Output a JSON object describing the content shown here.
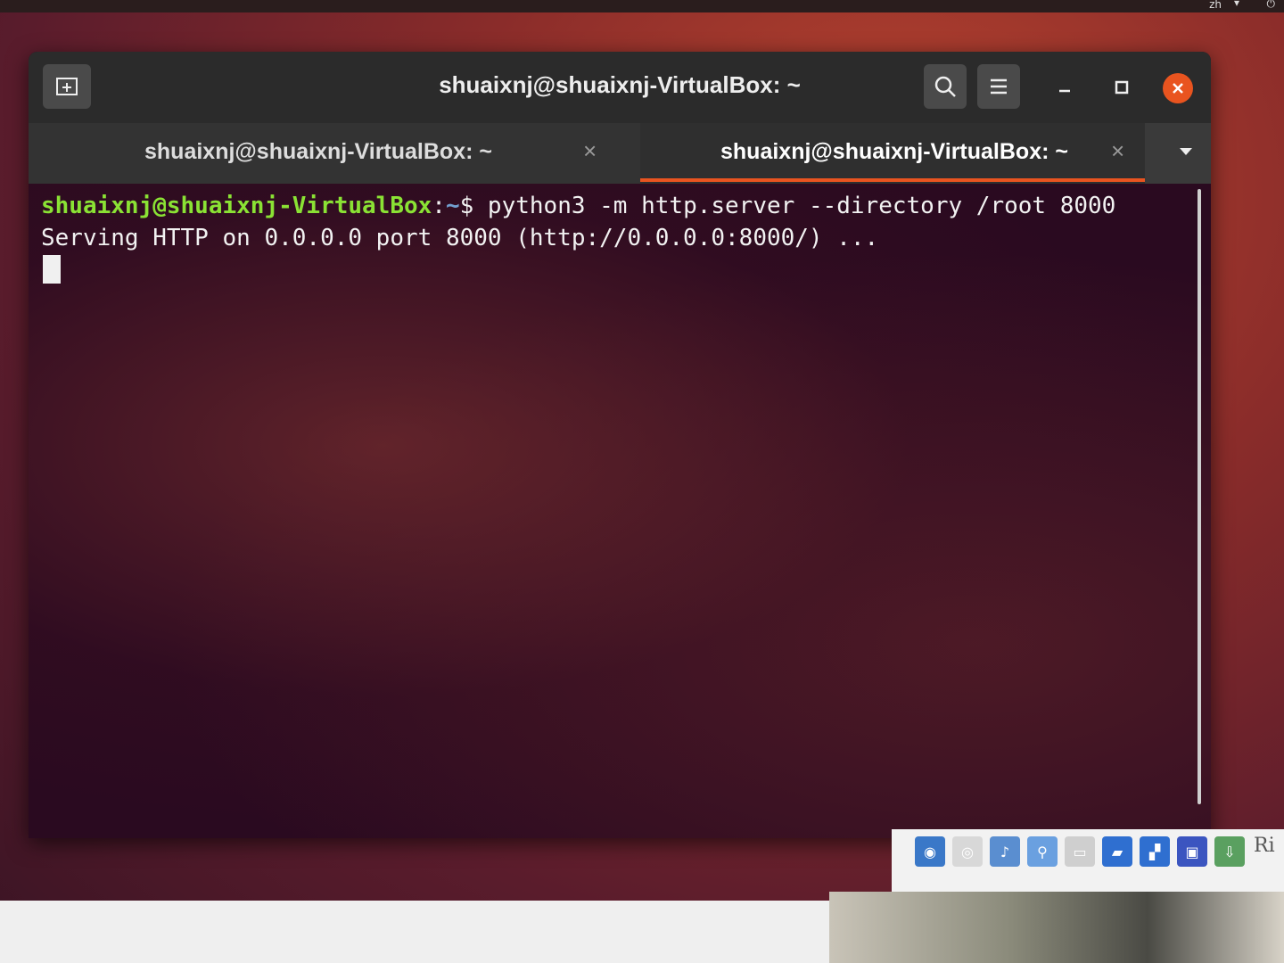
{
  "topbar": {
    "lang": "zh",
    "chevron_icon": "chevron-down-icon",
    "power_icon": "power-icon"
  },
  "window": {
    "title": "shuaixnj@shuaixnj-VirtualBox: ~",
    "new_tab_icon": "new-tab-icon",
    "search_icon": "search-icon",
    "menu_icon": "hamburger-menu-icon",
    "minimize_icon": "minimize-icon",
    "maximize_icon": "maximize-icon",
    "close_icon": "close-icon"
  },
  "tabs": [
    {
      "label": "shuaixnj@shuaixnj-VirtualBox: ~",
      "close": "×",
      "active": false
    },
    {
      "label": "shuaixnj@shuaixnj-VirtualBox: ~",
      "close": "×",
      "active": true
    }
  ],
  "terminal": {
    "prompt_user": "shuaixnj@shuaixnj-VirtualBox",
    "prompt_sep": ":",
    "prompt_path": "~",
    "prompt_symbol": "$ ",
    "command": "python3 -m http.server --directory /root 8000",
    "output": "Serving HTTP on 0.0.0.0 port 8000 (http://0.0.0.0:8000/) ..."
  },
  "host_taskbar": {
    "label": "Ri"
  },
  "colors": {
    "accent": "#e95420",
    "prompt_user": "#8ae234",
    "prompt_path": "#729fcf",
    "terminal_bg": "#2a0a20"
  }
}
